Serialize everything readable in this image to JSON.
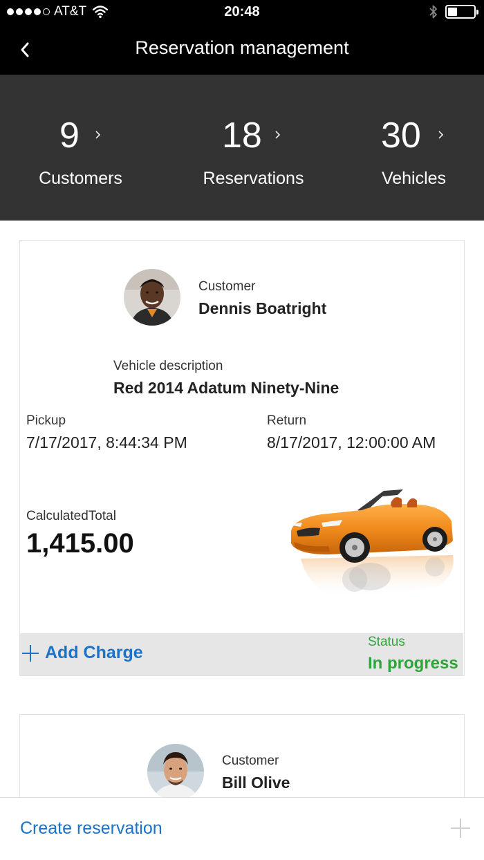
{
  "status_bar": {
    "carrier": "AT&T",
    "time": "20:48",
    "signal_icon": "signal-dots-icon",
    "wifi_icon": "wifi-icon",
    "bluetooth_icon": "bluetooth-icon",
    "battery_icon": "battery-icon",
    "battery_level": 0.35
  },
  "nav": {
    "title": "Reservation management",
    "back_icon": "chevron-left-icon"
  },
  "stats": [
    {
      "count": "9",
      "label": "Customers"
    },
    {
      "count": "18",
      "label": "Reservations"
    },
    {
      "count": "30",
      "label": "Vehicles"
    }
  ],
  "reservations": [
    {
      "customer_label": "Customer",
      "customer_name": "Dennis Boatright",
      "vehicle_label": "Vehicle description",
      "vehicle": "Red 2014 Adatum Ninety-Nine",
      "pickup_label": "Pickup",
      "pickup": "7/17/2017, 8:44:34 PM",
      "return_label": "Return",
      "return": "8/17/2017, 12:00:00 AM",
      "total_label": "CalculatedTotal",
      "total": "1,415.00",
      "add_charge": "Add Charge",
      "status_label": "Status",
      "status": "In progress"
    },
    {
      "customer_label": "Customer",
      "customer_name": "Bill Olive"
    }
  ],
  "bottom": {
    "create_label": "Create reservation",
    "plus_icon": "plus-icon"
  },
  "colors": {
    "accent_blue": "#1a73c8",
    "status_green": "#2ea43a",
    "stats_bg": "#333333",
    "car_orange": "#f08a1c"
  }
}
